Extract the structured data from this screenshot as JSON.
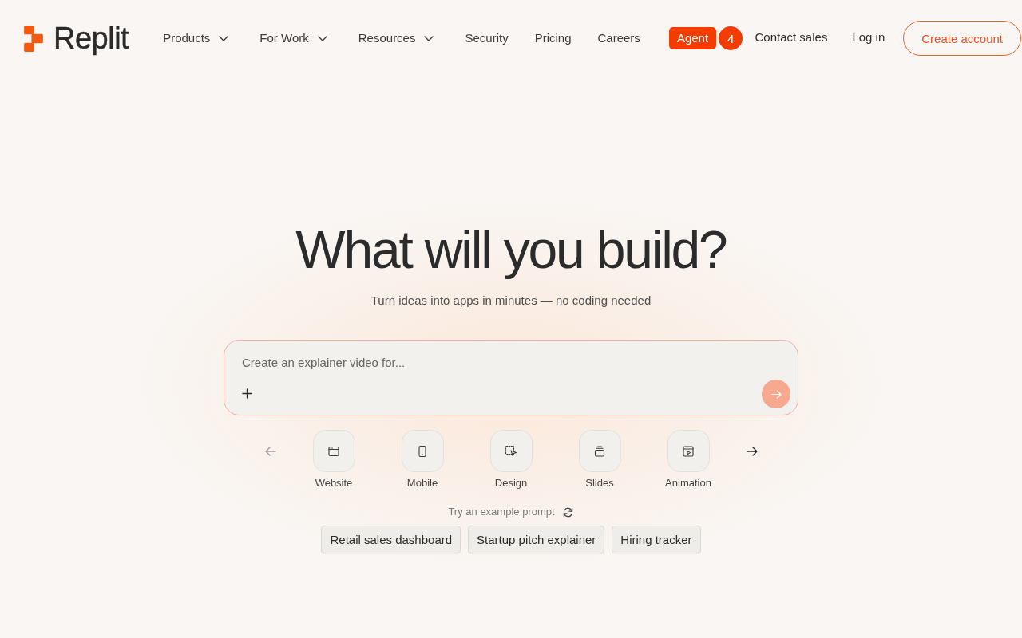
{
  "logo": {
    "text": "Replit"
  },
  "nav": {
    "items": [
      {
        "label": "Products",
        "dropdown": true
      },
      {
        "label": "For Work",
        "dropdown": true
      },
      {
        "label": "Resources",
        "dropdown": true
      },
      {
        "label": "Security",
        "dropdown": false
      },
      {
        "label": "Pricing",
        "dropdown": false
      },
      {
        "label": "Careers",
        "dropdown": false
      }
    ],
    "agent": {
      "label": "Agent",
      "badge": "4"
    },
    "actions": [
      {
        "kind": "link",
        "label": "Contact sales"
      },
      {
        "kind": "link",
        "label": "Log in"
      },
      {
        "kind": "outline",
        "label": "Create account"
      }
    ]
  },
  "hero": {
    "title": "What will you build?",
    "subtitle": "Turn ideas into apps in minutes — no coding needed"
  },
  "prompt": {
    "placeholder": "Create an explainer video for...",
    "send_disabled": true
  },
  "carousel": {
    "prev_disabled": true,
    "next_disabled": false
  },
  "modes": [
    {
      "kind": "website",
      "label": "Website"
    },
    {
      "kind": "mobile",
      "label": "Mobile"
    },
    {
      "kind": "design",
      "label": "Design"
    },
    {
      "kind": "slides",
      "label": "Slides"
    },
    {
      "kind": "animation",
      "label": "Animation"
    }
  ],
  "examples": {
    "label": "Try an example prompt",
    "chips": [
      "Retail sales dashboard",
      "Startup pitch explainer",
      "Hiring tracker"
    ]
  }
}
